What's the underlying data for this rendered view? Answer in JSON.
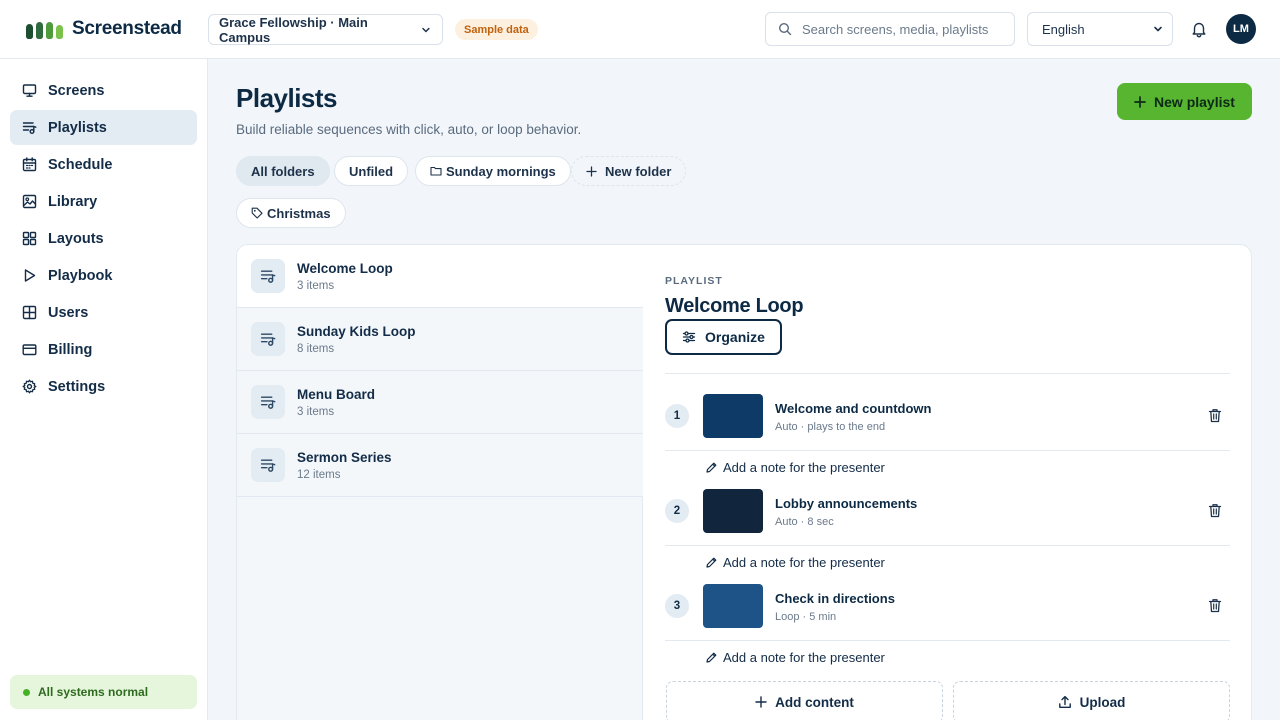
{
  "app": {
    "name": "Screenstead",
    "logo_colors": [
      "#1d4e2f",
      "#2f6b3d",
      "#4f9a3a",
      "#7cc24a"
    ]
  },
  "header": {
    "org_select": "Grace Fellowship · Main Campus",
    "sample_badge": "Sample data",
    "search_placeholder": "Search screens, media, playlists",
    "language": "English",
    "avatar_initials": "LM"
  },
  "sidebar": {
    "items": [
      {
        "label": "Screens",
        "icon": "monitor-icon"
      },
      {
        "label": "Playlists",
        "icon": "playlist-icon",
        "active": true
      },
      {
        "label": "Schedule",
        "icon": "calendar-icon"
      },
      {
        "label": "Library",
        "icon": "image-icon"
      },
      {
        "label": "Layouts",
        "icon": "layout-grid-icon"
      },
      {
        "label": "Playbook",
        "icon": "play-icon"
      },
      {
        "label": "Users",
        "icon": "users-grid-icon"
      },
      {
        "label": "Billing",
        "icon": "credit-card-icon"
      },
      {
        "label": "Settings",
        "icon": "gear-icon"
      }
    ],
    "status": "All systems normal"
  },
  "page": {
    "title": "Playlists",
    "subtitle": "Build reliable sequences with click, auto, or loop behavior.",
    "new_button": "New playlist"
  },
  "filters": {
    "all": "All folders",
    "unfiled": "Unfiled",
    "folder": "Sunday mornings",
    "new_folder": "New folder",
    "tag": "Christmas"
  },
  "playlists": [
    {
      "name": "Welcome Loop",
      "count": "3 items"
    },
    {
      "name": "Sunday Kids Loop",
      "count": "8 items"
    },
    {
      "name": "Menu Board",
      "count": "3 items"
    },
    {
      "name": "Sermon Series",
      "count": "12 items"
    }
  ],
  "detail": {
    "eyebrow": "PLAYLIST",
    "title": "Welcome Loop",
    "organize": "Organize",
    "note_label": "Add a note for the presenter",
    "items": [
      {
        "num": "1",
        "name": "Welcome and countdown",
        "meta": "Auto · plays to the end",
        "color": "#0d3a66"
      },
      {
        "num": "2",
        "name": "Lobby announcements",
        "meta": "Auto · 8 sec",
        "color": "#11253d"
      },
      {
        "num": "3",
        "name": "Check in directions",
        "meta": "Loop · 5 min",
        "color": "#1e5388"
      }
    ],
    "add_content": "Add content",
    "upload": "Upload"
  }
}
